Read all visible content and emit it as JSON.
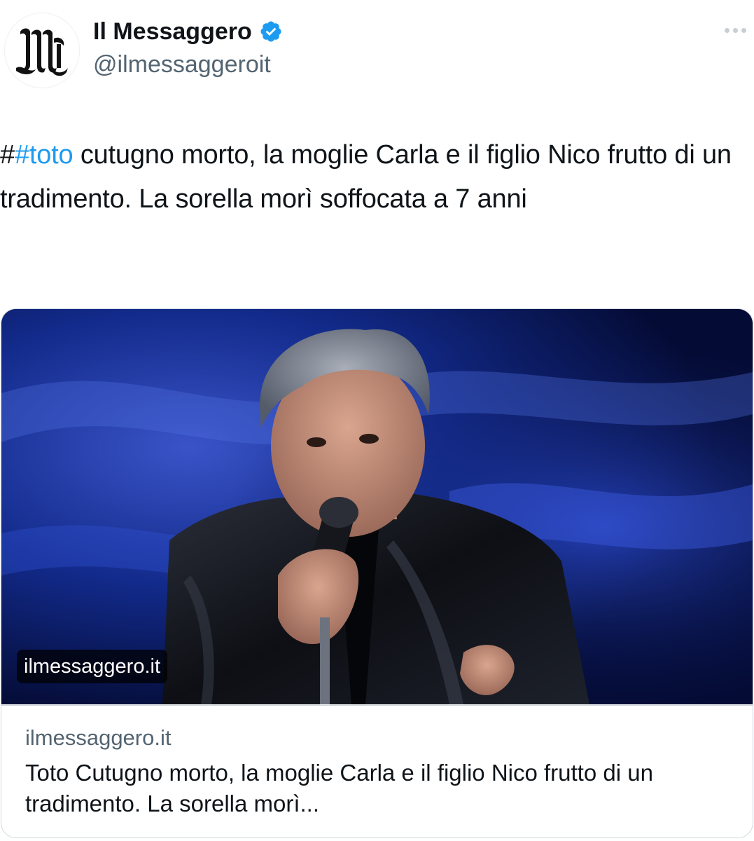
{
  "account": {
    "display_name": "Il Messaggero",
    "handle": "@ilmessaggeroit",
    "avatar_icon": "il-messaggero-gothic-m-logo",
    "verified_icon": "verified-badge-icon",
    "verified_color": "#1d9bf0"
  },
  "more_icon": "more-horizontal-icon",
  "tweet": {
    "hash_prefix": "#",
    "hashtag": "#toto",
    "text_rest": " cutugno morto, la moglie Carla e il figlio Nico frutto di un tradimento. La sorella morì soffocata a 7 anni"
  },
  "card": {
    "image_domain_overlay": "ilmessaggero.it",
    "domain": "ilmessaggero.it",
    "title": "Toto Cutugno morto, la moglie Carla e il figlio Nico frutto di un tradimento. La sorella morì..."
  },
  "colors": {
    "link": "#1d9bf0",
    "text": "#0f1419",
    "secondary_text": "#536471",
    "border": "#cfd9de"
  }
}
